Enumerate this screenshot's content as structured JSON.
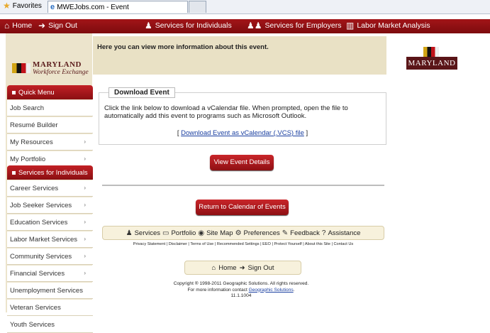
{
  "browser": {
    "favorites_label": "Favorites",
    "tab_title": "MWEJobs.com - Event"
  },
  "topnav": {
    "home": "Home",
    "sign_out": "Sign Out",
    "services_individuals": "Services for Individuals",
    "services_employers": "Services for Employers",
    "labor_market": "Labor Market Analysis"
  },
  "logo": {
    "line1": "MARYLAND",
    "line2": "Workforce Exchange"
  },
  "sidebar": {
    "quick_menu_title": "Quick Menu",
    "quick_menu": [
      {
        "label": "Job Search",
        "arrow": false
      },
      {
        "label": "Resumé Builder",
        "arrow": false
      },
      {
        "label": "My Resources",
        "arrow": true
      },
      {
        "label": "My Portfolio",
        "arrow": true
      }
    ],
    "services_title": "Services for Individuals",
    "services": [
      {
        "label": "Career Services",
        "arrow": true
      },
      {
        "label": "Job Seeker Services",
        "arrow": true
      },
      {
        "label": "Education Services",
        "arrow": true
      },
      {
        "label": "Labor Market Services",
        "arrow": true
      },
      {
        "label": "Community Services",
        "arrow": true
      },
      {
        "label": "Financial Services",
        "arrow": true
      },
      {
        "label": "Unemployment Services",
        "arrow": false
      },
      {
        "label": "Veteran Services",
        "arrow": false
      },
      {
        "label": "Youth Services",
        "arrow": false
      }
    ]
  },
  "main": {
    "banner_text": "Here you can view more information about this event.",
    "md_logo": "MARYLAND",
    "download": {
      "legend": "Download Event",
      "body": "Click the link below to download a vCalendar file. When prompted, open the file to automatically add this event to programs such as Microsoft Outlook.",
      "link_prefix": "[ ",
      "link_text": "Download Event as vCalendar (.VCS) file",
      "link_suffix": " ]"
    },
    "view_details_button": "View Event Details",
    "return_button": "Return to Calendar of Events"
  },
  "footer": {
    "nav": [
      "Services",
      "Portfolio",
      "Site Map",
      "Preferences",
      "Feedback",
      "Assistance"
    ],
    "links": "Privacy Statement | Disclaimer | Terms of Use | Recommended Settings | EEO | Protect Yourself | About this Site | Contact Us",
    "home": "Home",
    "sign_out": "Sign Out",
    "copyright": "Copyright ® 1998-2011 Geographic Solutions. All rights reserved.",
    "contact_prefix": "For more information contact ",
    "contact_link": "Geographic Solutions",
    "contact_suffix": ".",
    "version": "11.1.1004"
  }
}
